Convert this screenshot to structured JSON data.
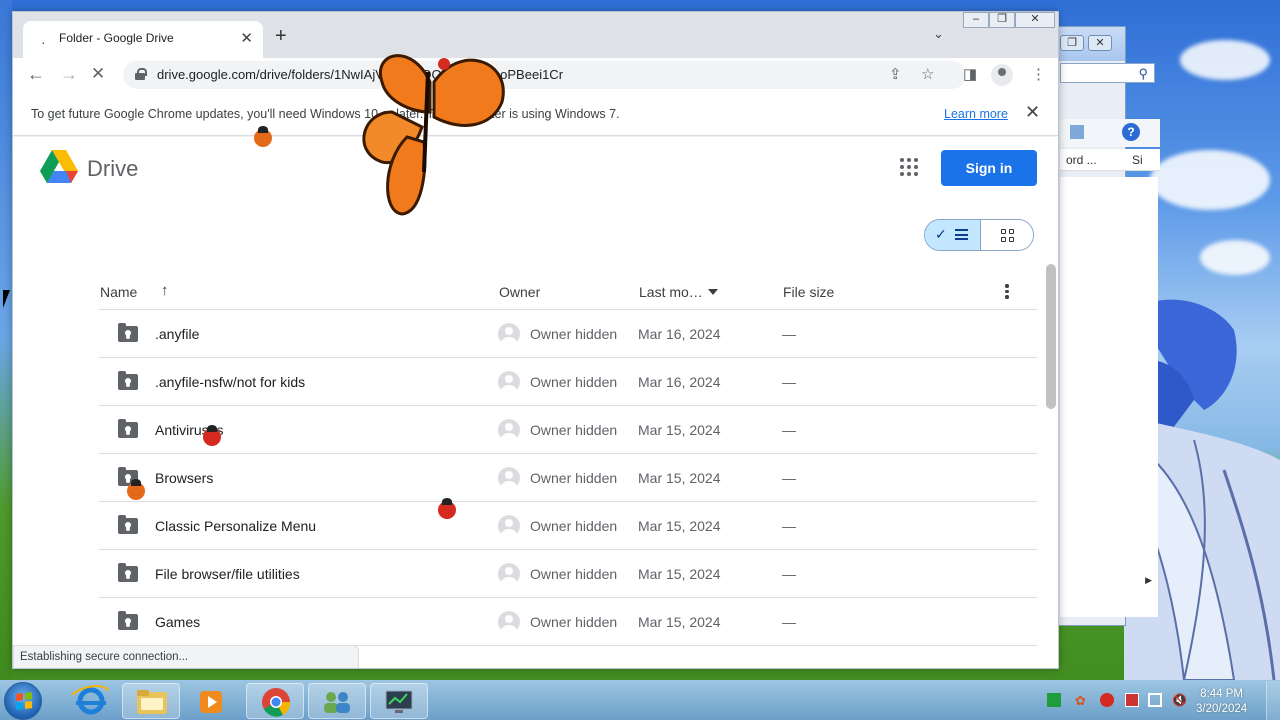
{
  "browser": {
    "tab": {
      "title": "Folder - Google Drive"
    },
    "url": "drive.google.com/drive/folders/1NwIAjVxHE…OQZJB4rZNcoPBeei1Cr",
    "infobar": {
      "message": "To get future Google Chrome updates, you'll need Windows 10 or later. This computer is using Windows 7.",
      "learn_more": "Learn more"
    },
    "status": "Establishing secure connection..."
  },
  "drive": {
    "brand": "Drive",
    "sign_in": "Sign in",
    "columns": {
      "name": "Name",
      "owner": "Owner",
      "last_modified": "Last mo…",
      "file_size": "File size"
    },
    "files": [
      {
        "name": ".anyfile",
        "owner": "Owner hidden",
        "modified": "Mar 16, 2024",
        "size": "—"
      },
      {
        "name": ".anyfile-nsfw/not for kids",
        "owner": "Owner hidden",
        "modified": "Mar 16, 2024",
        "size": "—"
      },
      {
        "name": "Antiviruses",
        "owner": "Owner hidden",
        "modified": "Mar 15, 2024",
        "size": "—"
      },
      {
        "name": "Browsers",
        "owner": "Owner hidden",
        "modified": "Mar 15, 2024",
        "size": "—"
      },
      {
        "name": "Classic Personalize Menu",
        "owner": "Owner hidden",
        "modified": "Mar 15, 2024",
        "size": "—"
      },
      {
        "name": "File browser/file utilities",
        "owner": "Owner hidden",
        "modified": "Mar 15, 2024",
        "size": "—"
      },
      {
        "name": "Games",
        "owner": "Owner hidden",
        "modified": "Mar 15, 2024",
        "size": "—"
      }
    ]
  },
  "desktop": {
    "bg_window": {
      "col1": "ord ...",
      "col2": "Si"
    }
  },
  "taskbar": {
    "time": "8:44 PM",
    "date": "3/20/2024"
  },
  "colors": {
    "accent": "#1a73e8",
    "toggle_selected": "#c2e7ff",
    "butterfly": "#f07a1c",
    "ladybug": "#d42a1f"
  }
}
